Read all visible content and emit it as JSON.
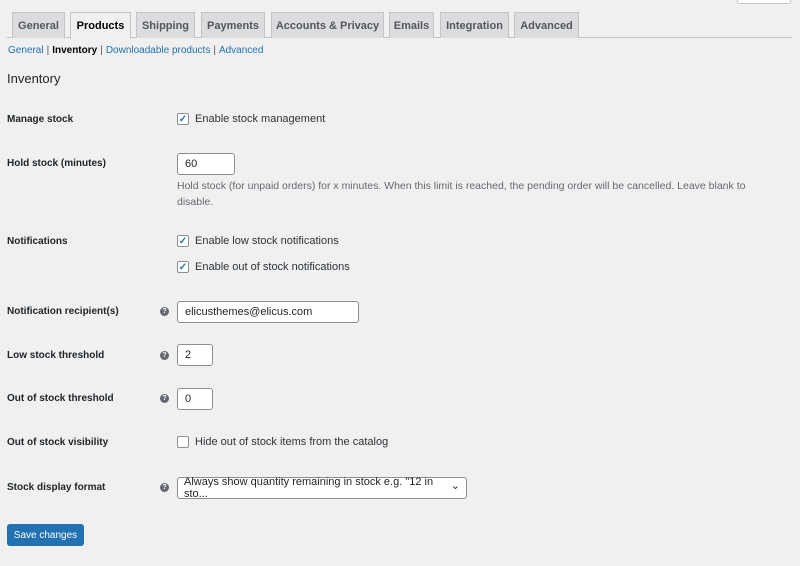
{
  "tabs": [
    {
      "label": "General"
    },
    {
      "label": "Products",
      "active": true
    },
    {
      "label": "Shipping"
    },
    {
      "label": "Payments"
    },
    {
      "label": "Accounts & Privacy"
    },
    {
      "label": "Emails"
    },
    {
      "label": "Integration"
    },
    {
      "label": "Advanced"
    }
  ],
  "subnav": {
    "general": "General",
    "inventory": "Inventory",
    "downloadable": "Downloadable products",
    "advanced": "Advanced",
    "sep": "|"
  },
  "section_title": "Inventory",
  "fields": {
    "manage_stock": {
      "label": "Manage stock",
      "option": "Enable stock management",
      "checked": true
    },
    "hold_stock": {
      "label": "Hold stock (minutes)",
      "value": "60",
      "description": "Hold stock (for unpaid orders) for x minutes. When this limit is reached, the pending order will be cancelled. Leave blank to disable."
    },
    "notifications": {
      "label": "Notifications",
      "low": "Enable low stock notifications",
      "low_checked": true,
      "out": "Enable out of stock notifications",
      "out_checked": true
    },
    "recipient": {
      "label": "Notification recipient(s)",
      "value": "elicusthemes@elicus.com"
    },
    "low_threshold": {
      "label": "Low stock threshold",
      "value": "2"
    },
    "out_threshold": {
      "label": "Out of stock threshold",
      "value": "0"
    },
    "visibility": {
      "label": "Out of stock visibility",
      "option": "Hide out of stock items from the catalog",
      "checked": false
    },
    "display_format": {
      "label": "Stock display format",
      "value": "Always show quantity remaining in stock e.g. \"12 in sto..."
    }
  },
  "icons": {
    "help": "?",
    "check": "✓",
    "chevron": "⌄"
  },
  "accent": "#2271b1",
  "save_label": "Save changes"
}
